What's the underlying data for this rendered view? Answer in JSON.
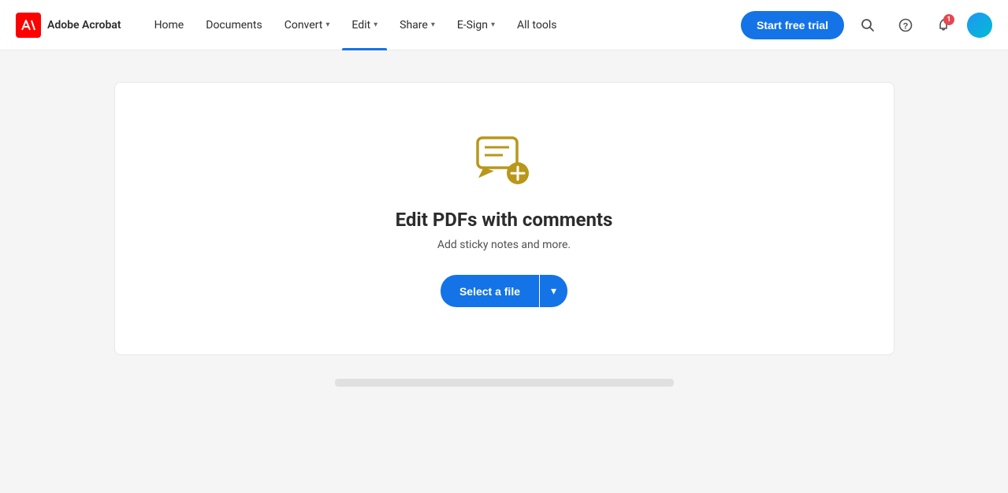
{
  "brand": {
    "logo_alt": "Adobe Acrobat logo",
    "name": "Adobe Acrobat"
  },
  "nav": {
    "items": [
      {
        "label": "Home",
        "active": false,
        "has_chevron": false
      },
      {
        "label": "Documents",
        "active": false,
        "has_chevron": false
      },
      {
        "label": "Convert",
        "active": false,
        "has_chevron": true
      },
      {
        "label": "Edit",
        "active": true,
        "has_chevron": true
      },
      {
        "label": "Share",
        "active": false,
        "has_chevron": true
      },
      {
        "label": "E-Sign",
        "active": false,
        "has_chevron": true
      },
      {
        "label": "All tools",
        "active": false,
        "has_chevron": false
      }
    ],
    "trial_button": "Start free trial",
    "notification_count": "1"
  },
  "card": {
    "title": "Edit PDFs with comments",
    "subtitle": "Add sticky notes and more.",
    "select_file_label": "Select a file",
    "chevron_label": "▾"
  }
}
